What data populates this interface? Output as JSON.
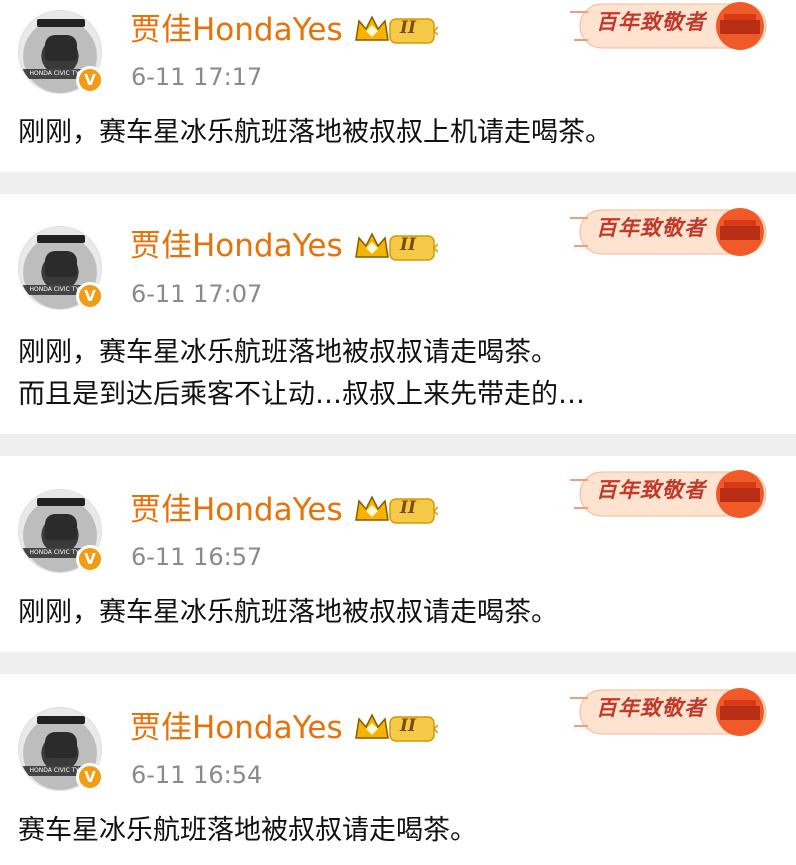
{
  "posts": [
    {
      "username": "贾佳HondaYes",
      "vip_level": "II",
      "timestamp": "6-11 17:17",
      "badge": "百年致敬者",
      "lines": [
        "刚刚，赛车星冰乐航班落地被叔叔上机请走喝茶。"
      ]
    },
    {
      "username": "贾佳HondaYes",
      "vip_level": "II",
      "timestamp": "6-11 17:07",
      "badge": "百年致敬者",
      "lines": [
        "刚刚，赛车星冰乐航班落地被叔叔请走喝茶。",
        "而且是到达后乘客不让动…叔叔上来先带走的…"
      ]
    },
    {
      "username": "贾佳HondaYes",
      "vip_level": "II",
      "timestamp": "6-11 16:57",
      "badge": "百年致敬者",
      "lines": [
        "刚刚，赛车星冰乐航班落地被叔叔请走喝茶。"
      ]
    },
    {
      "username": "贾佳HondaYes",
      "vip_level": "II",
      "timestamp": "6-11 16:54",
      "badge": "百年致敬者",
      "lines": [
        "赛车星冰乐航班落地被叔叔请走喝茶。"
      ]
    }
  ],
  "avatar_band_text": "HONDA CIVIC TYPE R",
  "verified_glyph": "V",
  "icons": {
    "verified": "verified-v-icon",
    "vip": "crown-vip-icon",
    "badge": "centennial-tribute-badge-icon"
  },
  "colors": {
    "username": "#e8710a",
    "timestamp": "#8a8a8a",
    "verified": "#f39c12",
    "badge_text": "#c0392b",
    "separator": "#efefef"
  }
}
